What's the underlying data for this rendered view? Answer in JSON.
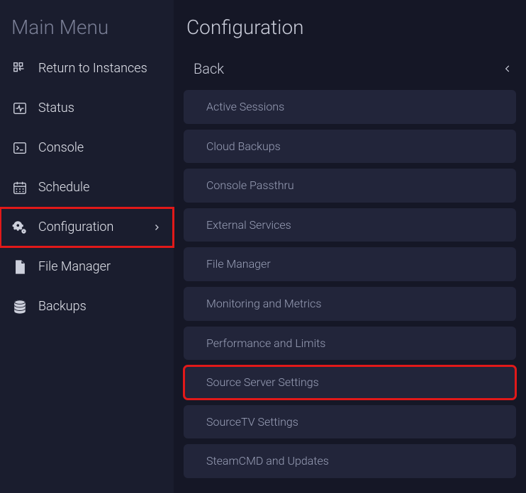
{
  "sidebar": {
    "title": "Main Menu",
    "items": [
      {
        "label": "Return to Instances"
      },
      {
        "label": "Status"
      },
      {
        "label": "Console"
      },
      {
        "label": "Schedule"
      },
      {
        "label": "Configuration",
        "highlighted": true,
        "has_chevron": true
      },
      {
        "label": "File Manager"
      },
      {
        "label": "Backups"
      }
    ]
  },
  "config": {
    "title": "Configuration",
    "back_label": "Back",
    "items": [
      {
        "label": "Active Sessions"
      },
      {
        "label": "Cloud Backups"
      },
      {
        "label": "Console Passthru"
      },
      {
        "label": "External Services"
      },
      {
        "label": "File Manager"
      },
      {
        "label": "Monitoring and Metrics"
      },
      {
        "label": "Performance and Limits"
      },
      {
        "label": "Source Server Settings",
        "highlighted": true
      },
      {
        "label": "SourceTV Settings"
      },
      {
        "label": "SteamCMD and Updates"
      }
    ]
  }
}
